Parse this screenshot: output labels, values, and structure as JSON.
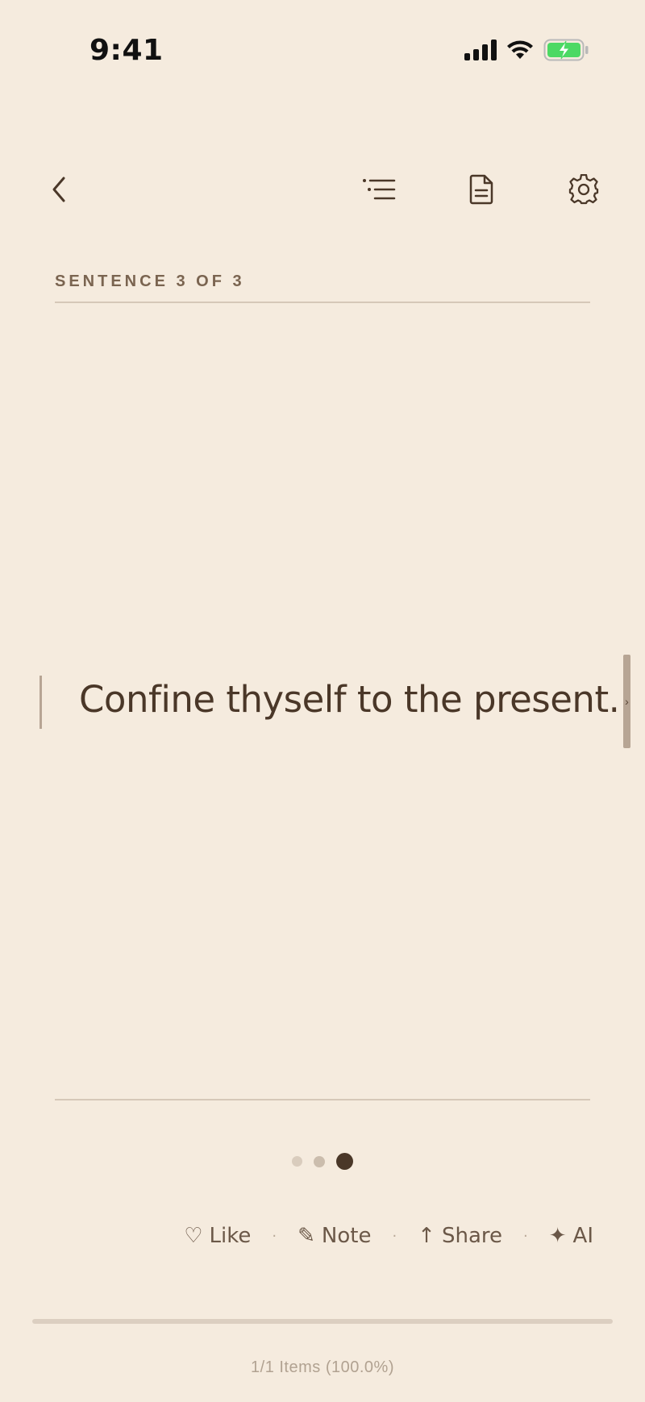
{
  "status_bar": {
    "time": "9:41",
    "icons": [
      "signal-icon",
      "wifi-icon",
      "battery-charging-icon"
    ]
  },
  "toolbar": {
    "back_icon": "chevron-left-icon",
    "contents_icon": "list-icon",
    "document_icon": "document-icon",
    "settings_icon": "gear-icon"
  },
  "section": {
    "label": "SENTENCE 3 OF 3"
  },
  "reader": {
    "sentence": "Confine thyself to the present."
  },
  "pager": {
    "total": 3,
    "current": 3
  },
  "actions": {
    "like_label": "Like",
    "note_label": "Note",
    "share_label": "Share",
    "ai_label": "AI",
    "separator": "·",
    "like_glyph": "♡",
    "note_glyph": "✎",
    "share_glyph": "↑",
    "ai_glyph": "✦"
  },
  "footer": {
    "progress_text": "1/1 Items (100.0%)"
  },
  "colors": {
    "background": "#f5ebde",
    "text": "#4a3728",
    "accent_bar": "#b7a594",
    "battery": "#4cd964"
  }
}
